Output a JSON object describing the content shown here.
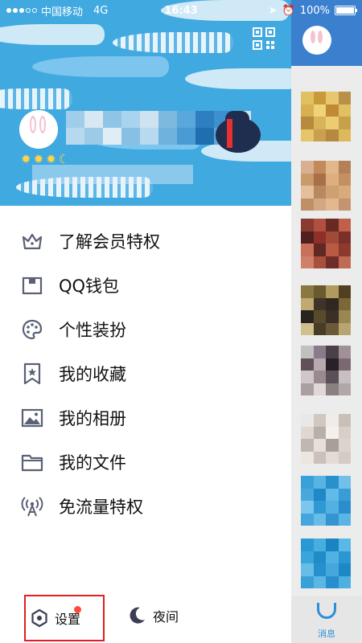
{
  "status_bar": {
    "carrier": "中国移动",
    "network": "4G",
    "time": "16:43",
    "battery_percent": "100%",
    "battery_level": 1.0
  },
  "header": {
    "avatar_icon": "bunny-avatar-icon",
    "qr_icon": "qr-code-icon"
  },
  "menu": {
    "items": [
      {
        "label": "了解会员特权",
        "icon": "crown-icon"
      },
      {
        "label": "QQ钱包",
        "icon": "wallet-icon"
      },
      {
        "label": "个性装扮",
        "icon": "palette-icon"
      },
      {
        "label": "我的收藏",
        "icon": "bookmark-star-icon"
      },
      {
        "label": "我的相册",
        "icon": "photo-icon"
      },
      {
        "label": "我的文件",
        "icon": "folder-icon"
      },
      {
        "label": "免流量特权",
        "icon": "antenna-icon"
      }
    ]
  },
  "bottom": {
    "settings_label": "设置",
    "night_label": "夜间"
  },
  "right_panel": {
    "tab_label": "消息"
  },
  "colors": {
    "header_blue": "#3fa9e0",
    "icon_gray": "#5a6075",
    "highlight_red": "#e02020",
    "accent_blue": "#2b90d9"
  }
}
